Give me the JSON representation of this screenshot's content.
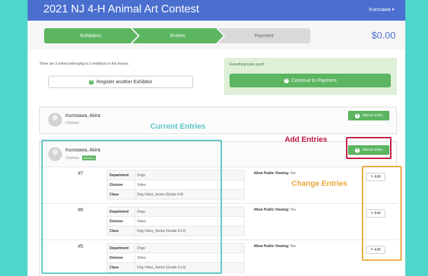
{
  "app": {
    "title": "2021 NJ 4-H Animal Art Contest",
    "user": "Kurosawa ▾"
  },
  "steps": {
    "exhibitors": "Exhibitors",
    "entries": "Entries",
    "payment": "Payment",
    "total": "$0.00"
  },
  "invoice": {
    "summary": "There are 3 entries belonging to 2 exhibitors in this invoice.",
    "register_label": "Register another Exhibitor"
  },
  "status": {
    "message": "Everything looks good!",
    "continue_label": "Continue to Payment"
  },
  "exhibitors": [
    {
      "name": "Kurosawa, Akira",
      "entries_text": "0 Entries",
      "add_label": "Add an Entry"
    },
    {
      "name": "Kurosawa, Akira",
      "entries_text": "3 Entries",
      "badge": "#6Online",
      "add_label": "Add an Entry"
    }
  ],
  "field_labels": {
    "department": "Department",
    "division": "Division",
    "class": "Class",
    "public": "Allow Public Viewing:"
  },
  "entries": [
    {
      "num": "#7",
      "department": "Dogs",
      "division": "Video",
      "class": "Dog Video_Junior (Grade 4-8)",
      "public": "Yes",
      "edit": "Edit"
    },
    {
      "num": "#6",
      "department": "Dogs",
      "division": "Video",
      "class": "Dog Video_Senior (Grade 9-13)",
      "public": "Yes",
      "edit": "Edit"
    },
    {
      "num": "#5",
      "department": "Dogs",
      "division": "Video",
      "class": "Dog Video_Senior (Grade 9-13)",
      "public": "Yes",
      "edit": "Edit"
    }
  ],
  "annotations": {
    "current": "Current Entries",
    "add": "Add Entries",
    "change": "Change Entries",
    "current_color": "#5bc5c7",
    "add_color": "#c0143c",
    "change_color": "#e8a93a"
  },
  "colors": {
    "background": "#4fd6cb",
    "header": "#4a6fcf",
    "accent": "#5cb560"
  }
}
